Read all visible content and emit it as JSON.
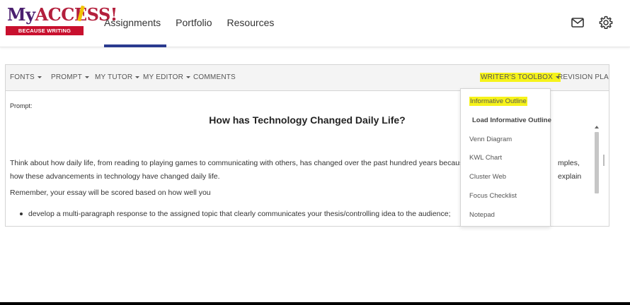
{
  "logo": {
    "brand_my": "My",
    "brand_access": "ACCESS",
    "brand_exclaim": "!",
    "tagline": "BECAUSE WRITING MATTERS"
  },
  "nav": {
    "items": [
      "Assignments",
      "Portfolio",
      "Resources"
    ]
  },
  "toolbar": {
    "fonts": "FONTS",
    "prompt": "PROMPT",
    "my_tutor": "MY TUTOR",
    "my_editor": "MY EDITOR",
    "comments": "COMMENTS",
    "writers_toolbox": "WRITER'S TOOLBOX",
    "revision_plan": "REVISION PLAN"
  },
  "content": {
    "prompt_label": "Prompt:",
    "title": "How has Technology Changed Daily Life?",
    "para1_a": "Think about how daily life, from reading to playing games to communicating with others, has changed over the past hundred years because of technology.",
    "para1_b": "mples, explain",
    "para1_c": "how these advancements in technology have changed daily life.",
    "para2": "Remember, your essay will be scored based on how well you",
    "bullet1": "develop a multi-paragraph response to the assigned topic that clearly communicates your thesis/controlling idea to the audience;"
  },
  "dropdown": {
    "items": [
      "Informative Outline",
      "Load Informative Outline",
      "Venn Diagram",
      "KWL Chart",
      "Cluster Web",
      "Focus Checklist",
      "Notepad"
    ]
  },
  "colors": {
    "highlight": "#f6f31a",
    "nav_underline": "#2a3a8f",
    "brand_red": "#c8102e",
    "brand_purple": "#4b1f6f"
  }
}
